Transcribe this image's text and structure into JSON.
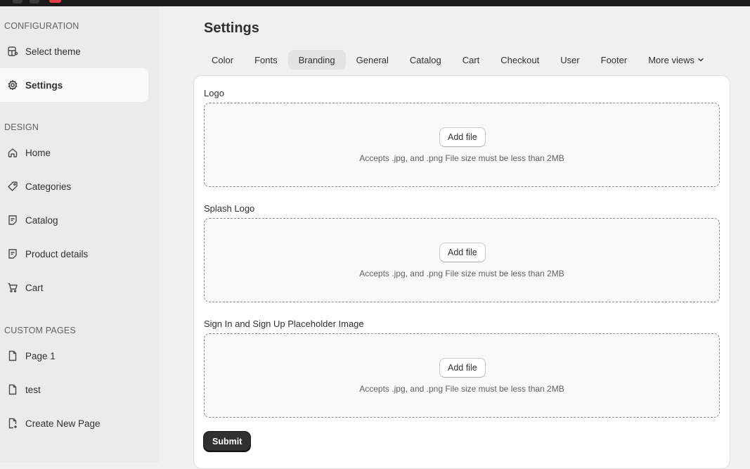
{
  "sidebar": {
    "sections": [
      {
        "title": "CONFIGURATION"
      },
      {
        "title": "DESIGN"
      },
      {
        "title": "CUSTOM PAGES"
      }
    ],
    "items": [
      {
        "label": "Select theme",
        "icon": "theme-icon"
      },
      {
        "label": "Settings",
        "icon": "gear-icon",
        "active": true
      },
      {
        "label": "Home",
        "icon": "home-icon"
      },
      {
        "label": "Categories",
        "icon": "tag-icon"
      },
      {
        "label": "Catalog",
        "icon": "catalog-icon"
      },
      {
        "label": "Product details",
        "icon": "catalog-icon"
      },
      {
        "label": "Cart",
        "icon": "cart-icon"
      },
      {
        "label": "Page 1",
        "icon": "page-icon"
      },
      {
        "label": "test",
        "icon": "page-icon"
      },
      {
        "label": "Create New Page",
        "icon": "page-add-icon"
      }
    ]
  },
  "main": {
    "title": "Settings",
    "tabs": [
      {
        "label": "Color"
      },
      {
        "label": "Fonts"
      },
      {
        "label": "Branding",
        "active": true
      },
      {
        "label": "General"
      },
      {
        "label": "Catalog"
      },
      {
        "label": "Cart"
      },
      {
        "label": "Checkout"
      },
      {
        "label": "User"
      },
      {
        "label": "Footer"
      },
      {
        "label": "More views"
      }
    ],
    "fields": [
      {
        "label": "Logo",
        "button": "Add file",
        "hint": "Accepts .jpg, and .png File size must be less than 2MB"
      },
      {
        "label": "Splash Logo",
        "button": "Add file",
        "hint": "Accepts .jpg, and .png File size must be less than 2MB"
      },
      {
        "label": "Sign In and Sign Up Placeholder Image",
        "button": "Add file",
        "hint": "Accepts .jpg, and .png File size must be less than 2MB"
      }
    ],
    "submit_label": "Submit"
  },
  "colors": {
    "accent": "#303030",
    "sidebar_bg": "#ebebeb",
    "page_bg": "#f1f1f1",
    "topbar": "#1a1a1a"
  }
}
